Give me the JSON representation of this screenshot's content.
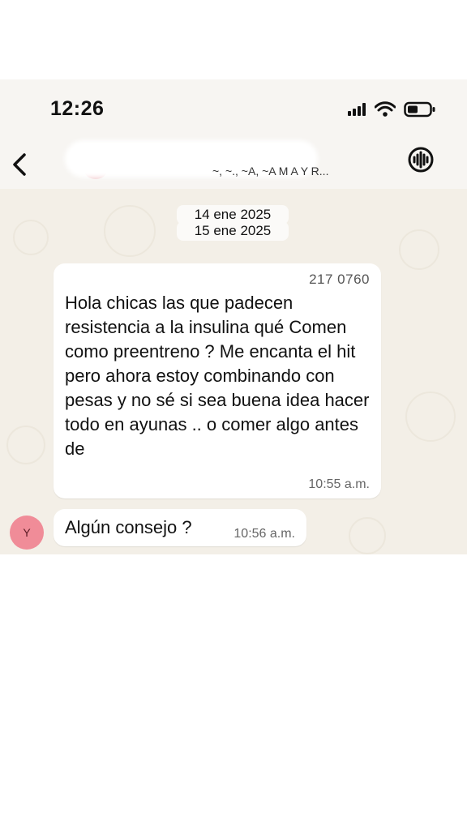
{
  "status_bar": {
    "time": "12:26"
  },
  "header": {
    "members": "~, ~., ~A, ~A M A Y R..."
  },
  "chat": {
    "dates": [
      "14 ene 2025",
      "15 ene 2025"
    ],
    "messages": [
      {
        "sender_number": "217 0760",
        "text": "Hola chicas las que padecen resistencia a la insulina qué Comen como preentreno ? Me encanta el hit  pero ahora estoy combinando con pesas y no sé si sea buena idea hacer todo en ayunas .. o comer algo antes de",
        "time": "10:55 a.m."
      },
      {
        "avatar_initial": "Y",
        "text": "Algún consejo ?",
        "time": "10:56 a.m."
      }
    ]
  },
  "colors": {
    "chat_bg": "#f3efe7",
    "bubble": "#ffffff",
    "avatar": "#f08c98"
  }
}
